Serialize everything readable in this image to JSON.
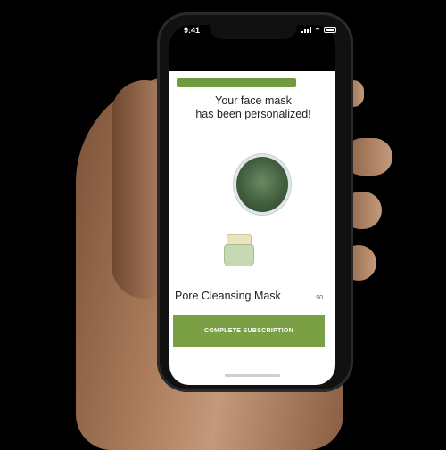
{
  "status_bar": {
    "time": "9:41"
  },
  "progress": {
    "fraction": 1.0,
    "color": "#6f9a3e"
  },
  "headline": {
    "line1": "Your face mask",
    "line2": "has been personalized!"
  },
  "product": {
    "name": "Pore Cleansing Mask",
    "price": "$0"
  },
  "cta": {
    "label": "COMPLETE SUBSCRIPTION",
    "color": "#7a9f45"
  },
  "icons": [
    "signal-icon",
    "wifi-icon",
    "battery-icon"
  ]
}
